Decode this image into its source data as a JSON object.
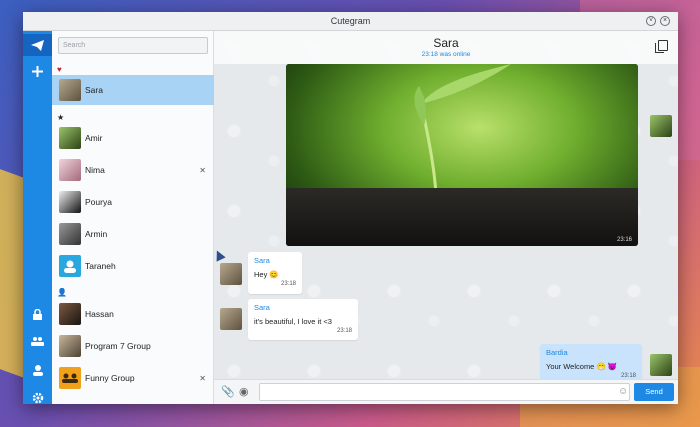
{
  "window": {
    "title": "Cutegram"
  },
  "rail": {
    "items": [
      {
        "icon": "paper-plane-icon"
      },
      {
        "icon": "plus-icon"
      },
      {
        "icon": "lock-icon"
      },
      {
        "icon": "group-icon"
      },
      {
        "icon": "user-icon"
      },
      {
        "icon": "gear-icon"
      }
    ]
  },
  "sidebar": {
    "search_placeholder": "Search",
    "sections": {
      "favorites_icon": "heart-icon",
      "starred_icon": "star-icon",
      "contacts_icon": "person-icon"
    },
    "contacts": [
      {
        "name": "Sara",
        "selected": true,
        "muted": false,
        "avatar_color": "#8c7d62"
      },
      {
        "name": "Amir",
        "selected": false,
        "muted": false,
        "avatar_color": "#4a6a2a"
      },
      {
        "name": "Nima",
        "selected": false,
        "muted": true,
        "avatar_color": "#d9a7b6"
      },
      {
        "name": "Pourya",
        "selected": false,
        "muted": false,
        "avatar_color": "#222222"
      },
      {
        "name": "Armin",
        "selected": false,
        "muted": false,
        "avatar_color": "#555555"
      },
      {
        "name": "Taraneh",
        "selected": false,
        "muted": false,
        "avatar_color": "#29a8e0"
      },
      {
        "name": "Hassan",
        "selected": false,
        "muted": false,
        "avatar_color": "#3a2a22"
      },
      {
        "name": "Program 7 Group",
        "selected": false,
        "muted": false,
        "avatar_color": "#8a7a66"
      },
      {
        "name": "Funny Group",
        "selected": false,
        "muted": true,
        "avatar_color": "#f0a01a"
      }
    ]
  },
  "chat": {
    "name": "Sara",
    "status": "23:18 was online",
    "photo_time": "23:16",
    "messages": [
      {
        "sender": "Sara",
        "text": "Hey 😊",
        "time": "23:18"
      },
      {
        "sender": "Sara",
        "text": "it's beautiful, I love it <3",
        "time": "23:18"
      },
      {
        "sender": "Bardia",
        "text": "Your Welcome 😁 😈",
        "time": "23:18"
      }
    ]
  },
  "composer": {
    "placeholder": "",
    "send_label": "Send"
  },
  "colors": {
    "accent": "#1e88e5",
    "selected_row": "#a9d3f5",
    "outgoing_bubble": "#c8e3fb"
  }
}
